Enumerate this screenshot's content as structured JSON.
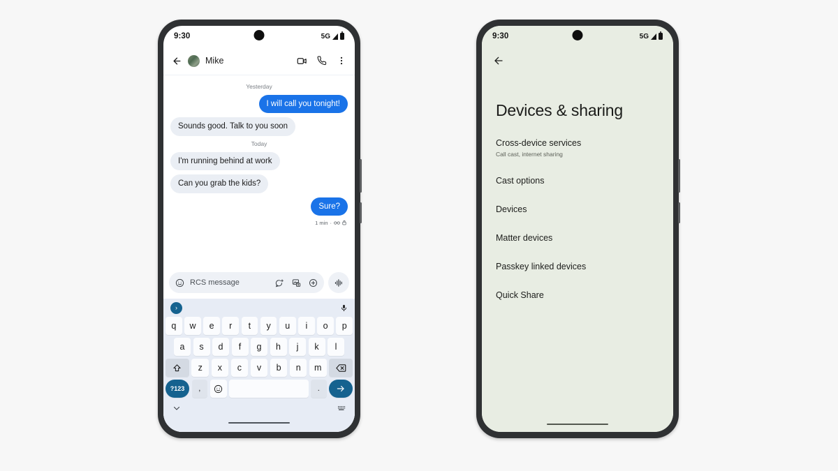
{
  "canvas": {
    "background": "#f7f7f7"
  },
  "phones": {
    "messages": {
      "status": {
        "clock": "9:30",
        "network": "5G",
        "signal_icon": "signal-triangle-icon",
        "battery_icon": "battery-full-icon"
      },
      "appbar": {
        "back_icon": "back-arrow-icon",
        "avatar_icon": "contact-avatar",
        "contact": "Mike",
        "video_icon": "video-call-icon",
        "call_icon": "phone-call-icon",
        "overflow_icon": "more-vertical-icon"
      },
      "thread": [
        {
          "type": "daystamp",
          "text": "Yesterday"
        },
        {
          "type": "message",
          "direction": "out",
          "text": "I will call you tonight!"
        },
        {
          "type": "message",
          "direction": "in",
          "text": "Sounds good. Talk to you soon"
        },
        {
          "type": "daystamp",
          "text": "Today"
        },
        {
          "type": "message",
          "direction": "in",
          "text": "I'm running behind at work"
        },
        {
          "type": "message",
          "direction": "in",
          "text": "Can you grab the kids?"
        },
        {
          "type": "message",
          "direction": "out",
          "text": "Sure?"
        }
      ],
      "last_meta": {
        "time": "1 min",
        "separator": "·",
        "rcs_icon": "rcs-glasses-icon",
        "lock_icon": "lock-icon"
      },
      "composer": {
        "emoji_icon": "emoji-smiley-icon",
        "placeholder": "RCS message",
        "sticker_icon": "sticker-bubble-plus-icon",
        "gallery_icon": "image-plus-icon",
        "plus_icon": "plus-circle-icon",
        "voice_icon": "audio-waveform-icon"
      },
      "keyboard": {
        "suggest_expand_icon": "chevron-right-icon",
        "suggest_mic_icon": "microphone-icon",
        "row1": [
          "q",
          "w",
          "e",
          "r",
          "t",
          "y",
          "u",
          "i",
          "o",
          "p"
        ],
        "row2": [
          "a",
          "s",
          "d",
          "f",
          "g",
          "h",
          "j",
          "k",
          "l"
        ],
        "row3_shift_icon": "shift-icon",
        "row3": [
          "z",
          "x",
          "c",
          "v",
          "b",
          "n",
          "m"
        ],
        "row3_backspace_icon": "backspace-icon",
        "symbols_key": "?123",
        "comma_key": ",",
        "emoji_key_icon": "emoji-smiley-icon",
        "space_key": "",
        "period_key": ".",
        "send_key_icon": "send-arrow-icon",
        "collapse_icon": "chevron-down-icon",
        "switch_keyboard_icon": "keyboard-icon"
      },
      "colors": {
        "outgoing_bubble": "#1a73e8",
        "incoming_bubble": "#eaeef4",
        "keyboard_bg": "#e7ecf5",
        "key_accent": "#15628f"
      }
    },
    "settings": {
      "status": {
        "clock": "9:30",
        "network": "5G",
        "signal_icon": "signal-triangle-icon",
        "battery_icon": "battery-full-icon"
      },
      "back_icon": "back-arrow-icon",
      "title": "Devices & sharing",
      "items": [
        {
          "title": "Cross-device services",
          "subtitle": "Call cast, internet sharing"
        },
        {
          "title": "Cast options",
          "subtitle": ""
        },
        {
          "title": "Devices",
          "subtitle": ""
        },
        {
          "title": "Matter devices",
          "subtitle": ""
        },
        {
          "title": "Passkey linked devices",
          "subtitle": ""
        },
        {
          "title": "Quick Share",
          "subtitle": ""
        }
      ],
      "colors": {
        "background": "#e8ede3",
        "text": "#1b1c1a",
        "subtext": "#5d6159"
      }
    }
  }
}
